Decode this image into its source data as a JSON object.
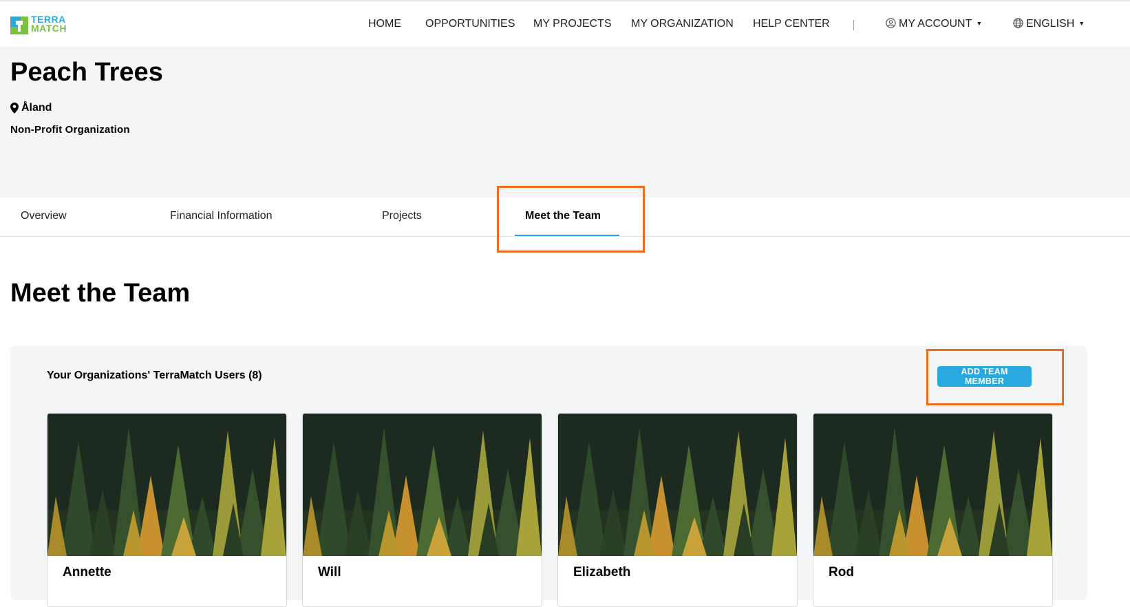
{
  "logo": {
    "line1": "TERRA",
    "line2": "MATCH"
  },
  "nav": {
    "home": "HOME",
    "opportunities": "OPPORTUNITIES",
    "my_projects": "MY PROJECTS",
    "my_organization": "MY ORGANIZATION",
    "help_center": "HELP CENTER",
    "my_account": "MY ACCOUNT",
    "language": "ENGLISH"
  },
  "organization": {
    "name": "Peach Trees",
    "location": "Åland",
    "type": "Non-Profit Organization"
  },
  "tabs": [
    {
      "label": "Overview"
    },
    {
      "label": "Financial Information"
    },
    {
      "label": "Projects"
    },
    {
      "label": "Meet the Team",
      "active": true
    }
  ],
  "team": {
    "section_title": "Meet the Team",
    "users_heading": "Your Organizations' TerraMatch Users (8)",
    "add_button": "ADD TEAM MEMBER",
    "members": [
      {
        "name": "Annette"
      },
      {
        "name": "Will"
      },
      {
        "name": "Elizabeth"
      },
      {
        "name": "Rod"
      }
    ]
  },
  "colors": {
    "accent": "#29a8e0",
    "logo_green": "#7ac142",
    "highlight": "#f26a1b",
    "hero_bg": "#f4f5f7"
  }
}
